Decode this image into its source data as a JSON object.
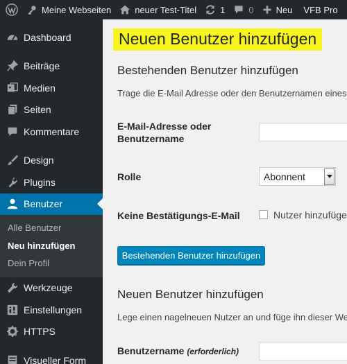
{
  "admin_bar": {
    "site_name": "Meine Webseiten",
    "page_title": "neuer Test-Titel",
    "updates_count": "1",
    "comments_count": "0",
    "new_label": "Neu",
    "plugin_label": "VFB Pro"
  },
  "sidebar": {
    "items_top": [
      {
        "label": "Dashboard",
        "icon": "dashboard-icon"
      },
      {
        "label": "Beiträge",
        "icon": "pin-icon"
      },
      {
        "label": "Medien",
        "icon": "media-icon"
      },
      {
        "label": "Seiten",
        "icon": "pages-icon"
      },
      {
        "label": "Kommentare",
        "icon": "comments-icon"
      },
      {
        "label": "Design",
        "icon": "brush-icon"
      },
      {
        "label": "Plugins",
        "icon": "plugin-icon"
      },
      {
        "label": "Benutzer",
        "icon": "user-icon"
      }
    ],
    "submenu": [
      "Alle Benutzer",
      "Neu hinzufügen",
      "Dein Profil"
    ],
    "items_bottom": [
      {
        "label": "Werkzeuge",
        "icon": "wrench-icon"
      },
      {
        "label": "Einstellungen",
        "icon": "settings-icon"
      },
      {
        "label": "HTTPS",
        "icon": "gear-icon"
      },
      {
        "label": "Visueller Form",
        "icon": "form-icon"
      }
    ]
  },
  "main": {
    "page_title": "Neuen Benutzer hinzufügen",
    "existing": {
      "heading": "Bestehenden Benutzer hinzufügen",
      "description": "Trage die E-Mail Adresse oder den Benutzernamen eines be",
      "email_label": "E-Mail-Adresse oder Benutzername",
      "email_value": "",
      "role_label": "Rolle",
      "role_value": "Abonnent",
      "noconfirm_label": "Keine Bestätigungs-E-Mail",
      "noconfirm_text": "Nutzer hinzufüge",
      "button": "Bestehenden Benutzer hinzufügen"
    },
    "new_user": {
      "heading": "Neuen Benutzer hinzufügen",
      "description": "Lege einen nagelneuen Nutzer an und füge ihn dieser Webs",
      "username_label": "Benutzername",
      "username_required": "(erforderlich)",
      "username_value": ""
    }
  },
  "colors": {
    "adminbar_bg": "#23282d",
    "sidebar_active": "#0073aa",
    "button_primary": "#0085ba",
    "title_highlight": "#f7f420"
  }
}
